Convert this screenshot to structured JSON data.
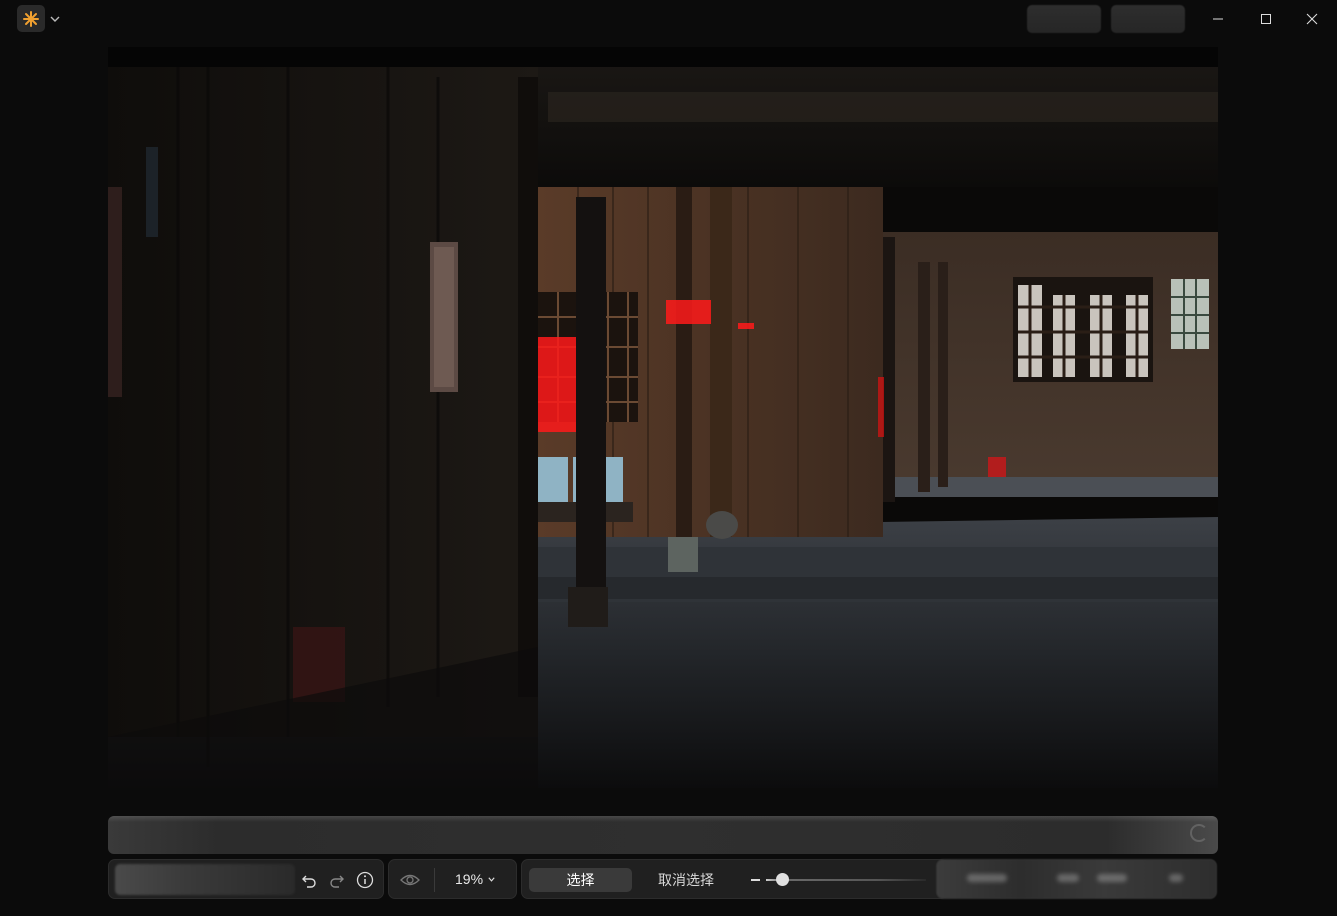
{
  "window": {
    "app_icon": "sparkle-icon",
    "controls": [
      "minimize-icon",
      "maximize-icon",
      "close-icon"
    ]
  },
  "colors": {
    "accent": "#f0a030",
    "background": "#0b0b0b",
    "toolbar": "#202020",
    "selected_segment": "#3a3a3a",
    "mask_overlay": "#ff1a1a"
  },
  "toolbar": {
    "undo_icon": "undo-icon",
    "redo_icon": "redo-icon",
    "info_icon": "info-icon",
    "visibility_icon": "eye-icon",
    "zoom_level": "19%",
    "select_label": "选择",
    "deselect_label": "取消选择",
    "brush_size_level": 0.1
  }
}
